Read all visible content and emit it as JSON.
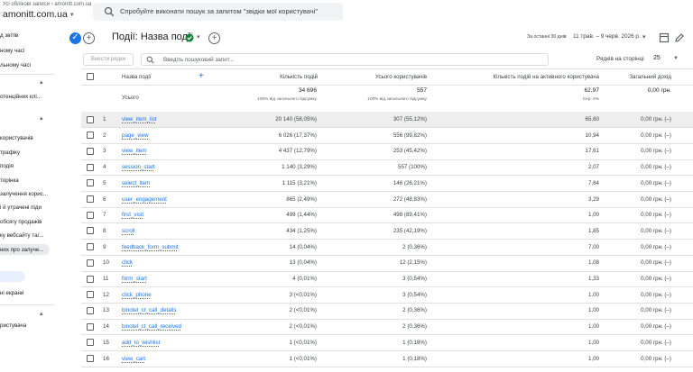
{
  "header": {
    "breadcrumb": "Усі облікові записи › amonitt.com.ua",
    "account": "amonitt.com.ua",
    "search_placeholder": "Спробуйте виконати пошук за запитом \"звідки мої користувачі\""
  },
  "sidebar": {
    "items": [
      "д звітів",
      "ному часі",
      "льному часі",
      "отенційних клі...",
      "користувачів",
      "трафіку",
      "подія",
      "торінка",
      "залучення корис...",
      "і й утрачені піди",
      "обсягу продажів",
      "ку вебсайту та/...",
      "них про залуче...",
      "ні екрани",
      "ристувача"
    ]
  },
  "report": {
    "title": "Події: Назва події",
    "date_label": "За останні 30 днів",
    "date_range": "11 трав. – 9 черв. 2026 р."
  },
  "controls": {
    "rows_button": "Внести рядки",
    "search_placeholder": "Введіть пошуковий запит...",
    "rows_per_page_label": "Рядків на сторінці",
    "rows_per_page": "25"
  },
  "table": {
    "columns": {
      "name": "Назва події",
      "events": "Кількість подій",
      "users": "Усього користувачів",
      "per_user": "Кількість подій на активного користувача",
      "revenue": "Загальний дохід"
    },
    "totals": {
      "label": "Усього",
      "events": "34 696",
      "events_sub": "100% від загального підсумку",
      "users": "557",
      "users_sub": "100% від загального підсумку",
      "per_user": "62,97",
      "per_user_sub": "Сер. 0%",
      "revenue": "0,00 грн."
    },
    "rows": [
      {
        "n": "1",
        "name": "view_item_list",
        "events": "20 140 (58,05%)",
        "users": "307 (55,12%)",
        "per_user": "65,60",
        "revenue": "0,00 грн. (–)"
      },
      {
        "n": "2",
        "name": "page_view",
        "events": "6 026 (17,37%)",
        "users": "556 (99,82%)",
        "per_user": "10,94",
        "revenue": "0,00 грн. (–)"
      },
      {
        "n": "3",
        "name": "view_item",
        "events": "4 437 (12,79%)",
        "users": "253 (45,42%)",
        "per_user": "17,61",
        "revenue": "0,00 грн. (–)"
      },
      {
        "n": "4",
        "name": "session_start",
        "events": "1 140 (3,29%)",
        "users": "557 (100%)",
        "per_user": "2,07",
        "revenue": "0,00 грн. (–)"
      },
      {
        "n": "5",
        "name": "select_item",
        "events": "1 115 (3,21%)",
        "users": "146 (26,21%)",
        "per_user": "7,64",
        "revenue": "0,00 грн. (–)"
      },
      {
        "n": "6",
        "name": "user_engagement",
        "events": "865 (2,49%)",
        "users": "272 (48,83%)",
        "per_user": "3,29",
        "revenue": "0,00 грн. (–)"
      },
      {
        "n": "7",
        "name": "first_visit",
        "events": "499 (1,44%)",
        "users": "498 (89,41%)",
        "per_user": "1,00",
        "revenue": "0,00 грн. (–)"
      },
      {
        "n": "8",
        "name": "scroll",
        "events": "434 (1,25%)",
        "users": "235 (42,19%)",
        "per_user": "1,85",
        "revenue": "0,00 грн. (–)"
      },
      {
        "n": "9",
        "name": "feedback_form_submit",
        "events": "14 (0,04%)",
        "users": "2 (0,36%)",
        "per_user": "7,00",
        "revenue": "0,00 грн. (–)"
      },
      {
        "n": "10",
        "name": "click",
        "events": "13 (0,04%)",
        "users": "12 (2,15%)",
        "per_user": "1,08",
        "revenue": "0,00 грн. (–)"
      },
      {
        "n": "11",
        "name": "form_start",
        "events": "4 (0,01%)",
        "users": "3 (0,54%)",
        "per_user": "1,33",
        "revenue": "0,00 грн. (–)"
      },
      {
        "n": "12",
        "name": "click_phone",
        "events": "3 (<0,01%)",
        "users": "3 (0,54%)",
        "per_user": "1,00",
        "revenue": "0,00 грн. (–)"
      },
      {
        "n": "13",
        "name": "binotel_ct_call_details",
        "events": "2 (<0,01%)",
        "users": "2 (0,36%)",
        "per_user": "1,00",
        "revenue": "0,00 грн. (–)"
      },
      {
        "n": "14",
        "name": "binotel_ct_call_received",
        "events": "2 (<0,01%)",
        "users": "2 (0,36%)",
        "per_user": "1,00",
        "revenue": "0,00 грн. (–)"
      },
      {
        "n": "15",
        "name": "add_to_wishlist",
        "events": "1 (<0,01%)",
        "users": "1 (0,18%)",
        "per_user": "1,00",
        "revenue": "0,00 грн. (–)"
      },
      {
        "n": "16",
        "name": "view_cart",
        "events": "1 (<0,01%)",
        "users": "1 (0,18%)",
        "per_user": "1,00",
        "revenue": "0,00 грн. (–)"
      }
    ]
  }
}
